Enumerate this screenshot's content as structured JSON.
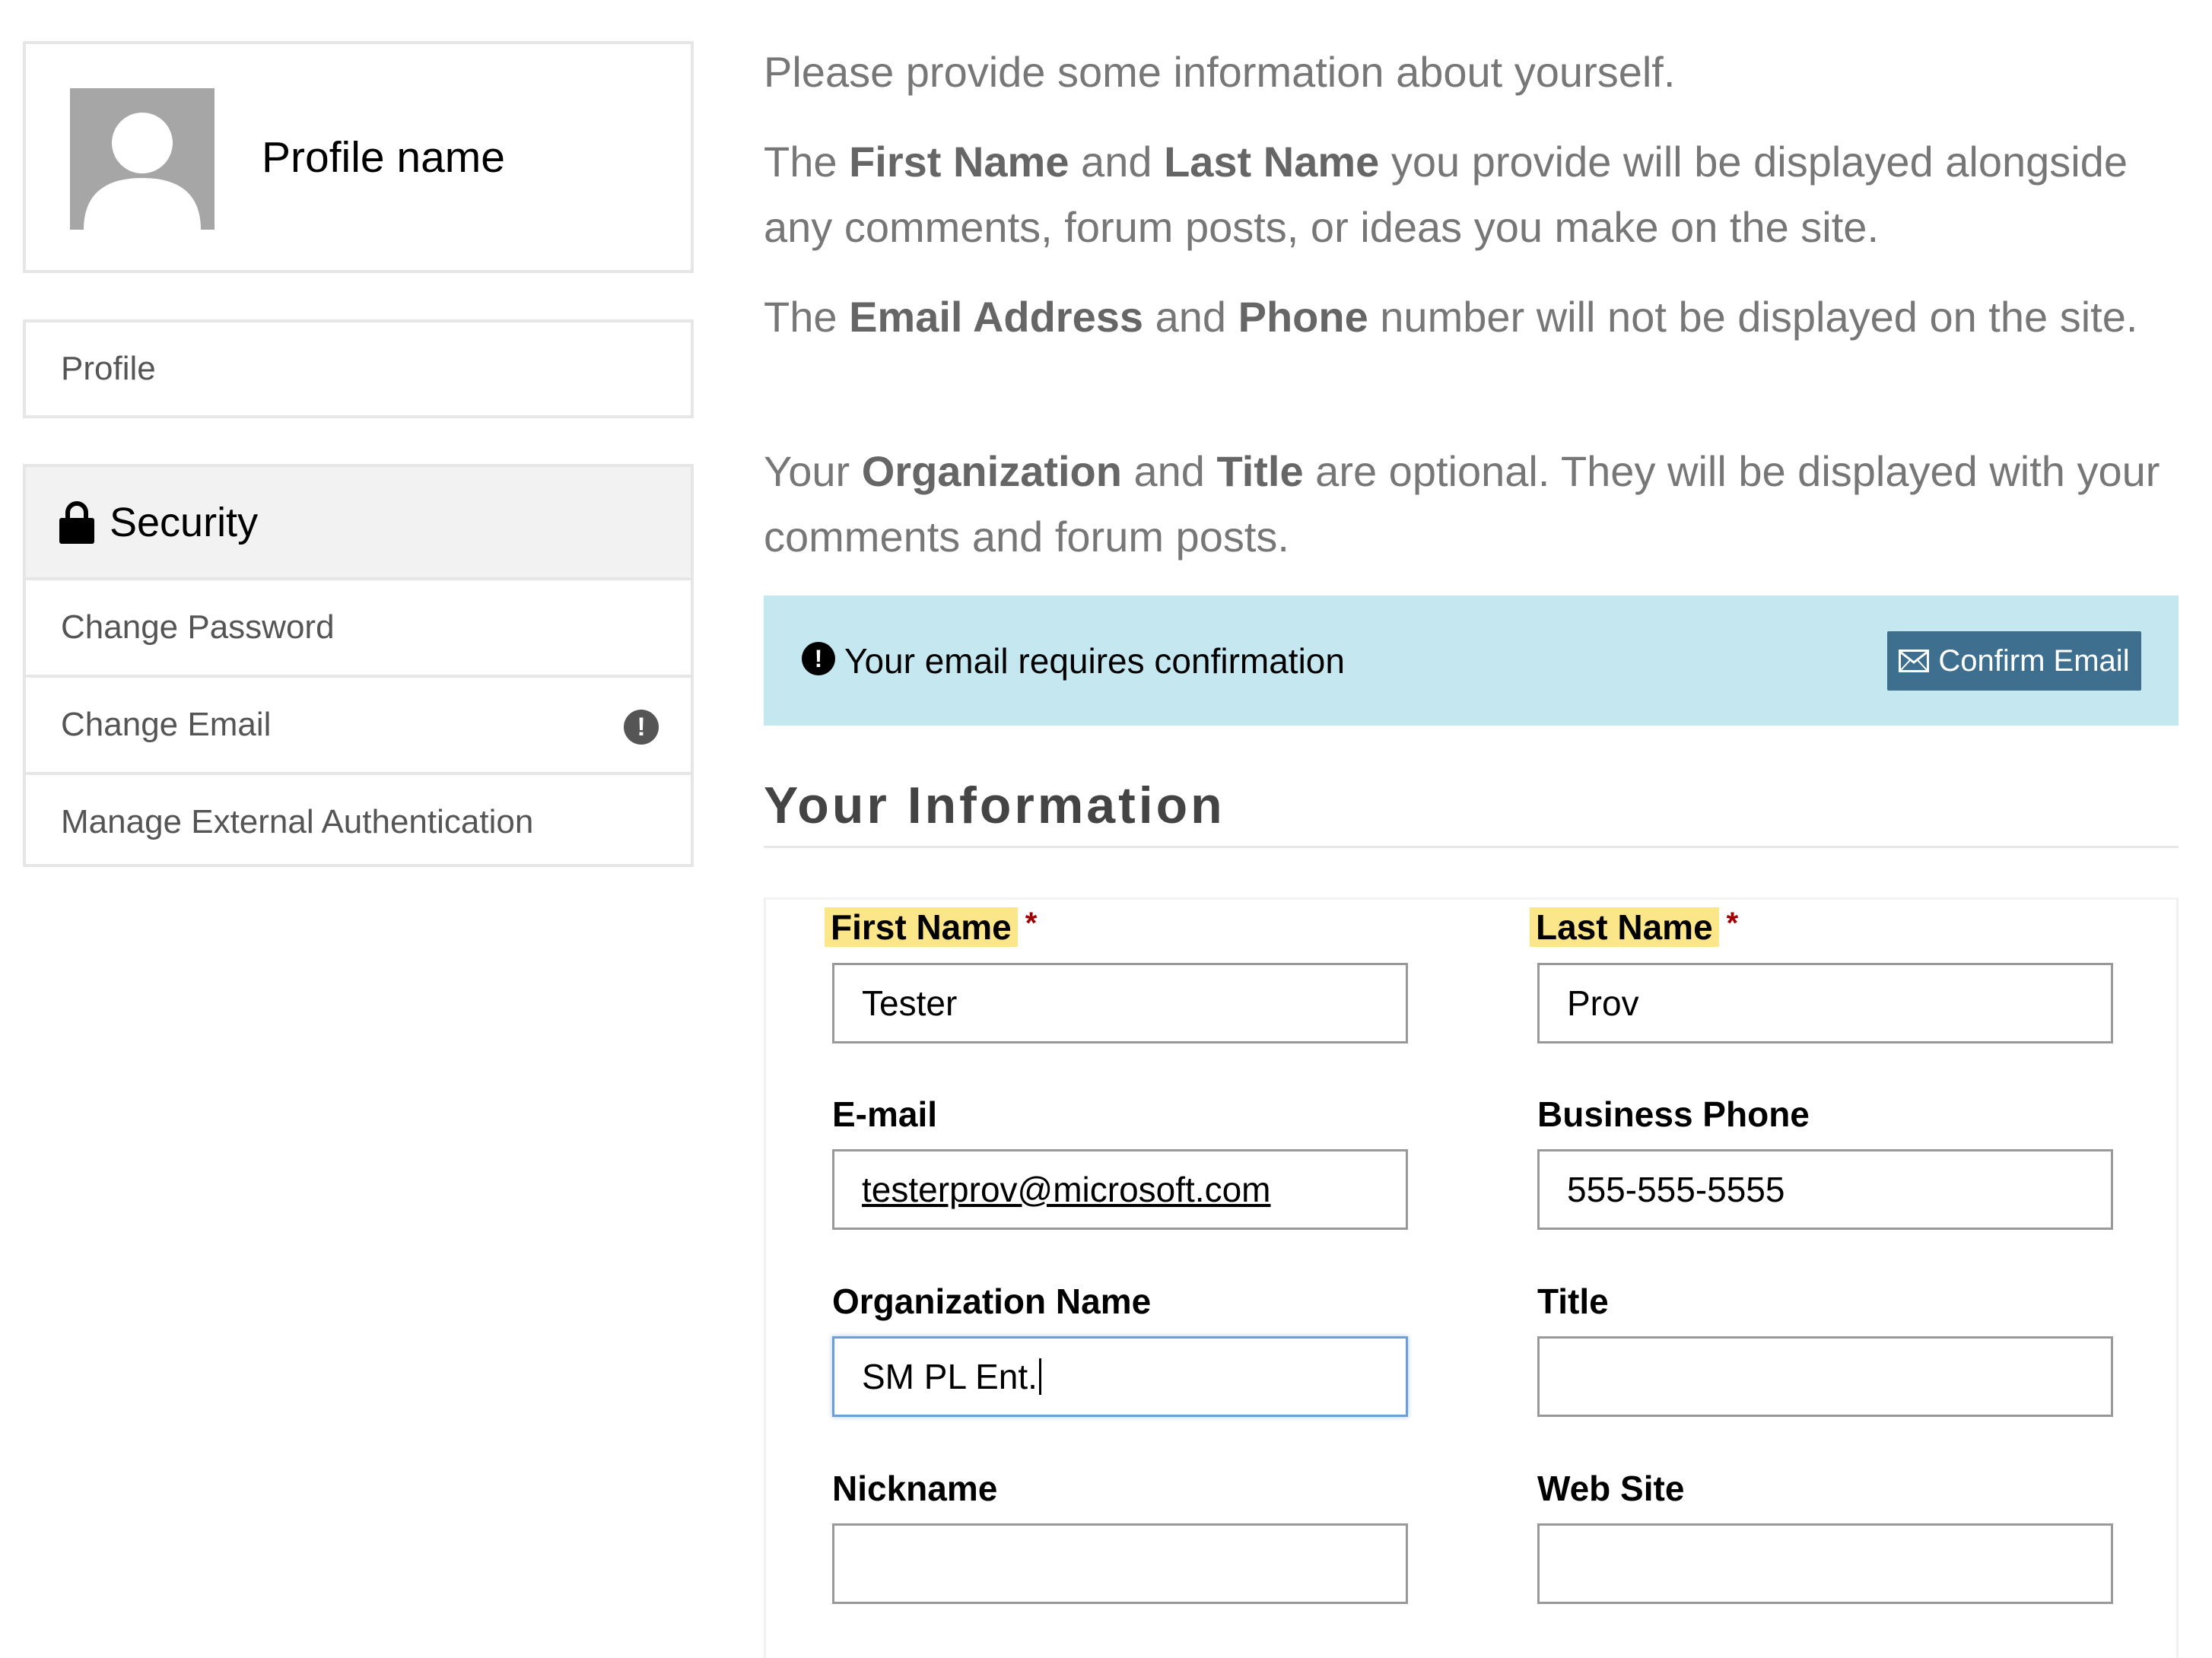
{
  "sidebar": {
    "profile_name": "Profile name",
    "profile_link": "Profile",
    "security": {
      "header": "Security",
      "items": [
        "Change Password",
        "Change Email",
        "Manage External Authentication"
      ]
    }
  },
  "intro": {
    "line1": "Please provide some information about yourself.",
    "p2": {
      "a": "The ",
      "b1": "First Name",
      "c": " and ",
      "b2": "Last Name",
      "d": " you provide will be displayed alongside any comments, forum posts, or ideas you make on the site."
    },
    "p3": {
      "a": "The ",
      "b1": "Email Address",
      "c": " and ",
      "b2": "Phone",
      "d": " number will not be displayed on the site."
    },
    "p4": {
      "a": "Your ",
      "b1": "Organization",
      "c": " and ",
      "b2": "Title",
      "d": " are optional. They will be displayed with your comments and forum posts."
    }
  },
  "alert": {
    "text": "Your email requires confirmation",
    "button": "Confirm Email"
  },
  "section_title": "Your Information",
  "form": {
    "first_name": {
      "label": "First Name",
      "required_mark": "*",
      "value": "Tester"
    },
    "last_name": {
      "label": "Last Name",
      "required_mark": "*",
      "value": "Prov"
    },
    "email": {
      "label": "E-mail",
      "value": "testerprov@microsoft.com"
    },
    "business_phone": {
      "label": "Business Phone",
      "value": "555-555-5555"
    },
    "organization": {
      "label": "Organization Name",
      "value": "SM PL Ent."
    },
    "title": {
      "label": "Title",
      "value": ""
    },
    "nickname": {
      "label": "Nickname",
      "value": ""
    },
    "web_site": {
      "label": "Web Site",
      "value": ""
    }
  },
  "colors": {
    "alert_bg": "#c5e7ef",
    "button_bg": "#3f6f8e",
    "required_highlight": "#fbe78a",
    "required_star": "#a00000",
    "focus_border": "#6a9fd8"
  },
  "icons": [
    "avatar-placeholder-icon",
    "lock-icon",
    "exclamation-circle-icon",
    "envelope-icon"
  ]
}
